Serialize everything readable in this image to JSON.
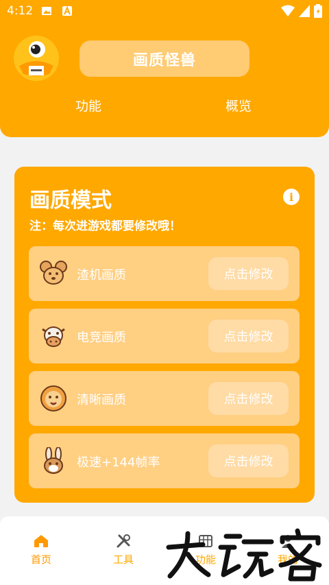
{
  "status_bar": {
    "time": "4:12"
  },
  "header": {
    "app_title": "画质怪兽",
    "tabs": [
      "功能",
      "概览"
    ]
  },
  "card": {
    "title": "画质模式",
    "note": "注：每次进游戏都要修改哦！",
    "modes": [
      {
        "label": "渣机画质",
        "button": "点击修改",
        "icon": "mouse-face-icon"
      },
      {
        "label": "电竞画质",
        "button": "点击修改",
        "icon": "cow-face-icon"
      },
      {
        "label": "清晰画质",
        "button": "点击修改",
        "icon": "lion-face-icon"
      },
      {
        "label": "极速+144帧率",
        "button": "点击修改",
        "icon": "rabbit-face-icon"
      }
    ]
  },
  "bottom_nav": [
    {
      "label": "首页",
      "icon": "home-icon",
      "active": true
    },
    {
      "label": "工具",
      "icon": "tools-icon",
      "active": false
    },
    {
      "label": "功能",
      "icon": "grid-icon",
      "active": false
    },
    {
      "label": "我的",
      "icon": "user-icon",
      "active": false
    }
  ],
  "colors": {
    "primary": "#ffa800",
    "light": "#ffcf82",
    "nav_active": "#ff9900",
    "nav_inactive": "#ffa800"
  }
}
